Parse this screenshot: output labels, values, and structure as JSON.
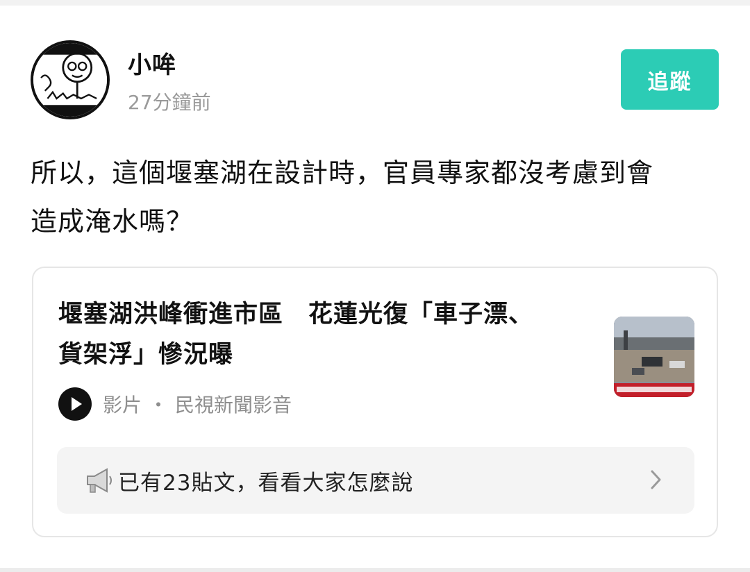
{
  "author": {
    "name": "小哞",
    "time": "27分鐘前"
  },
  "follow_button": {
    "label": "追蹤",
    "color": "#2cccb5"
  },
  "post": {
    "lines": [
      "所以，這個堰塞湖在設計時，官員專家都沒考慮到會",
      "造成淹水嗎？"
    ]
  },
  "shared_card": {
    "title_lines": [
      "堰塞湖洪峰衝進市區　花蓮光復「車子漂、",
      "貨架浮」慘況曝"
    ],
    "type_icon": "play-icon",
    "type_label": "影片",
    "separator": "・",
    "source": "民視新聞影音",
    "thumbnail_icon": "news-video-thumbnail",
    "discussion": {
      "icon": "megaphone-icon",
      "text": "已有23貼文，看看大家怎麼說",
      "chevron_icon": "chevron-right-icon"
    }
  }
}
